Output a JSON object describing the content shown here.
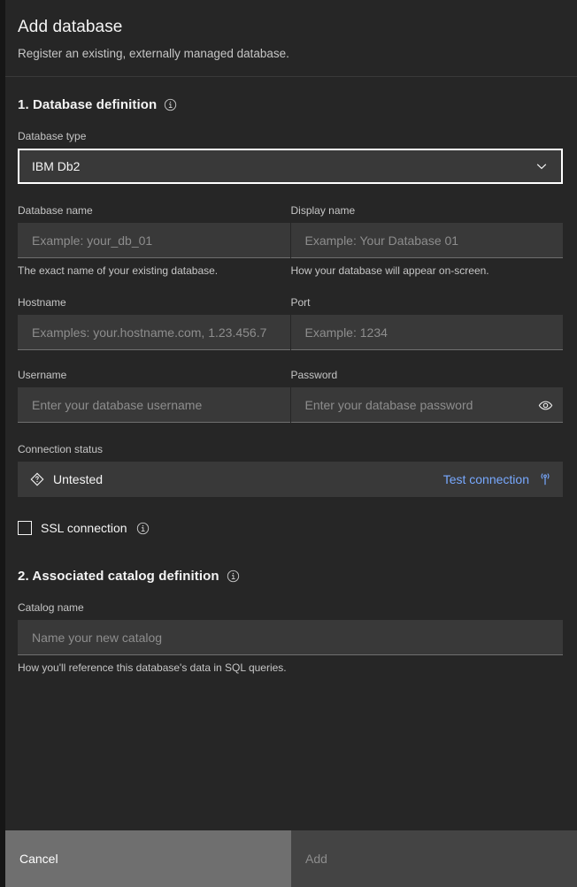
{
  "header": {
    "title": "Add database",
    "subtitle": "Register an existing, externally managed database."
  },
  "section1": {
    "title": "1. Database definition",
    "info_icon": "info-icon",
    "database_type": {
      "label": "Database type",
      "value": "IBM Db2",
      "chevron_icon": "chevron-down-icon"
    },
    "database_name": {
      "label": "Database name",
      "value": "",
      "placeholder": "Example: your_db_01",
      "helper": "The exact name of your existing database."
    },
    "display_name": {
      "label": "Display name",
      "value": "",
      "placeholder": "Example: Your Database 01",
      "helper": "How your database will appear on-screen."
    },
    "hostname": {
      "label": "Hostname",
      "value": "",
      "placeholder": "Examples: your.hostname.com, 1.23.456.7"
    },
    "port": {
      "label": "Port",
      "value": "",
      "placeholder": "Example: 1234"
    },
    "username": {
      "label": "Username",
      "value": "",
      "placeholder": "Enter your database username"
    },
    "password": {
      "label": "Password",
      "value": "",
      "placeholder": "Enter your database password",
      "reveal_icon": "eye-icon"
    },
    "connection": {
      "label": "Connection status",
      "status_icon": "unknown-diamond-icon",
      "status_text": "Untested",
      "test_label": "Test connection",
      "test_icon": "broadcast-icon"
    },
    "ssl": {
      "label": "SSL connection",
      "checked": false,
      "info_icon": "info-icon"
    }
  },
  "section2": {
    "title": "2. Associated catalog definition",
    "info_icon": "info-icon",
    "catalog_name": {
      "label": "Catalog name",
      "value": "",
      "placeholder": "Name your new catalog",
      "helper": "How you'll reference this database's data in SQL queries."
    }
  },
  "footer": {
    "cancel_label": "Cancel",
    "add_label": "Add"
  },
  "colors": {
    "panel_bg": "#262626",
    "field_bg": "#393939",
    "link_blue": "#78a9ff",
    "cancel_bg": "#6f6f6f",
    "add_bg": "#444444",
    "focus_outline": "#ffffff"
  }
}
